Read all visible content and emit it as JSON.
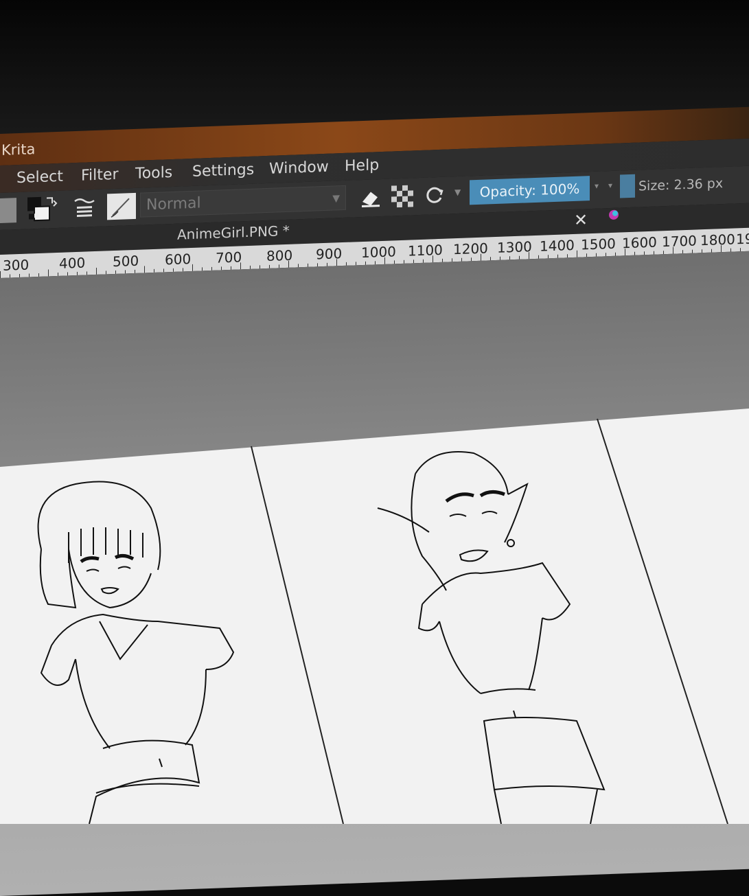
{
  "window": {
    "title": "Krita"
  },
  "menu": [
    "Select",
    "Filter",
    "Tools",
    "Settings",
    "Window",
    "Help"
  ],
  "toolbar": {
    "blend_mode": "Normal",
    "opacity_label": "Opacity: 100%",
    "size_label": "Size: 2.36 px"
  },
  "document": {
    "tab_title": "AnimeGirl.PNG *"
  },
  "ruler": {
    "labels": [
      "300",
      "400",
      "500",
      "600",
      "700",
      "800",
      "900",
      "1000",
      "1100",
      "1200",
      "1300",
      "1400",
      "1500",
      "1600",
      "1700",
      "1800",
      "19"
    ]
  },
  "colors": {
    "titlebar": "#8b4818",
    "accent": "#4a8db8",
    "panel": "#323232",
    "canvas": "#f3f3f3"
  },
  "icons": [
    "swap-colors-icon",
    "brush-presets-icon",
    "brush-preview-icon",
    "eraser-icon",
    "alpha-lock-icon",
    "reload-icon",
    "chevron-down-icon",
    "close-icon",
    "color-dot-icon"
  ]
}
